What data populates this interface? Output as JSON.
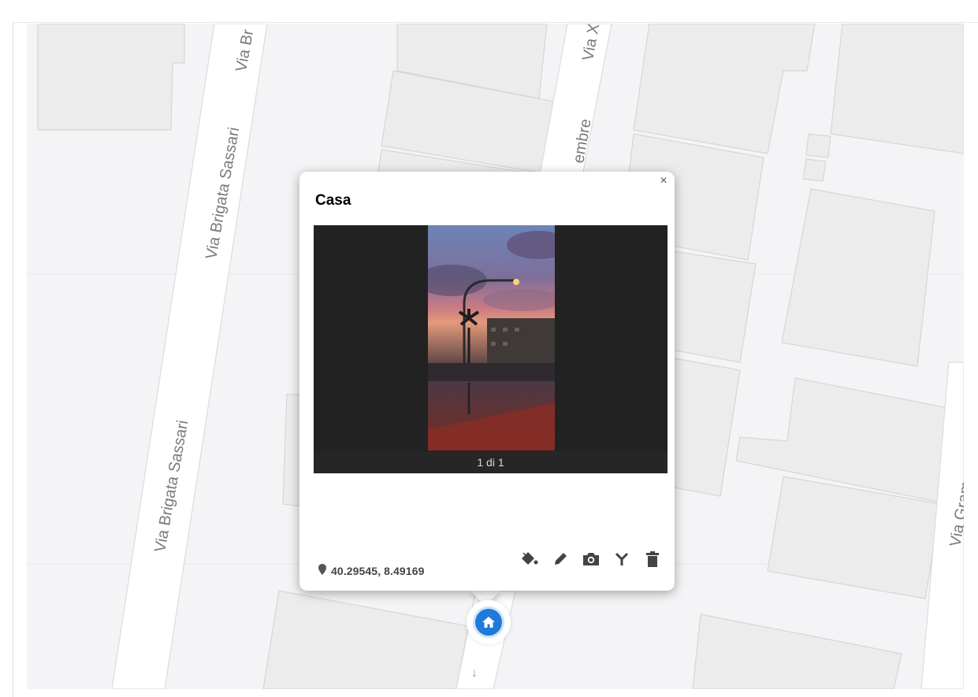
{
  "map": {
    "streets": [
      "Via Brigata Sassari",
      "Via Brigata Sassari",
      "Via Br",
      "Via X",
      "embre",
      "Via Gram"
    ],
    "colors": {
      "background": "#f4f4f6",
      "block": "#ececec",
      "road": "#ffffff"
    }
  },
  "popup": {
    "title": "Casa",
    "close_label": "×",
    "gallery_counter": "1 di 1",
    "coordinates": "40.29545, 8.49169",
    "icons": {
      "location": "map-pin-icon",
      "actions": [
        "paint-bucket-icon",
        "pencil-icon",
        "camera-icon",
        "route-split-icon",
        "trash-icon"
      ]
    }
  },
  "marker": {
    "icon": "home-icon",
    "color": "#1f7ad9"
  }
}
